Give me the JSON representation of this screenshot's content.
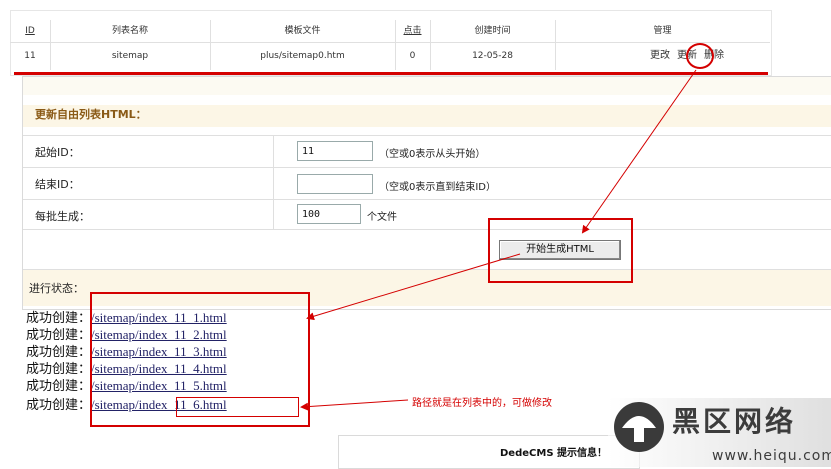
{
  "top_table": {
    "headers": [
      "ID",
      "列表名称",
      "模板文件",
      "点击",
      "创建时间",
      "管理"
    ],
    "row": {
      "id": "11",
      "name": "sitemap",
      "template": "plus/sitemap0.htm",
      "clicks": "0",
      "created": "12-05-28",
      "actions": [
        "更改",
        "更新",
        "删除"
      ]
    }
  },
  "form": {
    "section_title": "更新自由列表HTML：",
    "start_id": {
      "label": "起始ID：",
      "value": "11",
      "hint": "（空或0表示从头开始）"
    },
    "end_id": {
      "label": "结束ID：",
      "value": "",
      "hint": "（空或0表示直到结束ID）"
    },
    "per_batch": {
      "label": "每批生成：",
      "value": "100",
      "unit": "个文件"
    },
    "start_button": "开始生成HTML",
    "progress_label": "进行状态："
  },
  "created": {
    "prefix": "成功创建：",
    "files": [
      "/sitemap/index_11_1.html",
      "/sitemap/index_11_2.html",
      "/sitemap/index_11_3.html",
      "/sitemap/index_11_4.html",
      "/sitemap/index_11_5.html",
      "/sitemap/index_11_6.html"
    ]
  },
  "annotation": {
    "note": "路径就是在列表中的，可做修改"
  },
  "message_box": {
    "title": "DedeCMS 提示信息！"
  },
  "watermark": {
    "name": "黑区网络",
    "url": "www.heiqu.com"
  },
  "colors": {
    "annotation_red": "#d40000",
    "section_header_bg": "#fcf6e6",
    "link": "#222266"
  }
}
